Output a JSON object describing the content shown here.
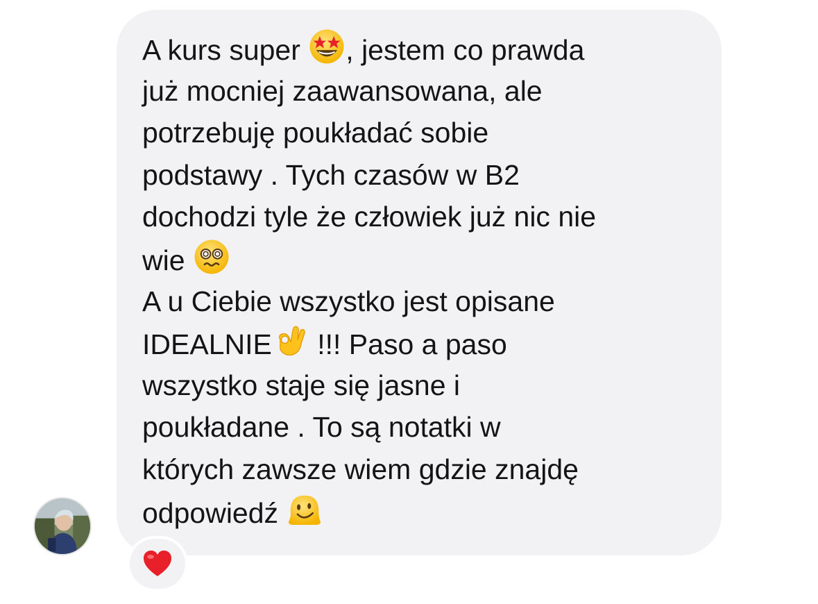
{
  "message": {
    "lines": [
      {
        "before": "A kurs super ",
        "emoji": "star-struck-emoji",
        "after": ", jestem co prawda"
      },
      {
        "text": "już mocniej zaawansowana, ale"
      },
      {
        "text": "potrzebuję poukładać sobie"
      },
      {
        "text": "podstawy . Tych czasów w B2"
      },
      {
        "text": "dochodzi tyle że człowiek już nic nie"
      },
      {
        "before": "wie ",
        "emoji": "face-with-spiral-eyes-emoji",
        "after": ""
      },
      {
        "text": "A u Ciebie wszystko jest opisane"
      },
      {
        "before": "IDEALNIE",
        "emoji": "ok-hand-emoji",
        "after": " !!! Paso a paso"
      },
      {
        "text": "wszystko staje się jasne i"
      },
      {
        "text": "poukładane . To są notatki w"
      },
      {
        "text": "których zawsze wiem gdzie znajdę"
      },
      {
        "before": "odpowiedź ",
        "emoji": "melting-face-emoji",
        "after": ""
      }
    ]
  },
  "reaction": {
    "emoji": "red-heart-emoji"
  },
  "sender": {
    "avatar_icon": "user-avatar"
  },
  "colors": {
    "bubble_background": "#f2f2f5",
    "text": "#141414",
    "page_background": "#ffffff",
    "heart": "#e8202a",
    "emoji_yellow": "#fcc21b"
  }
}
